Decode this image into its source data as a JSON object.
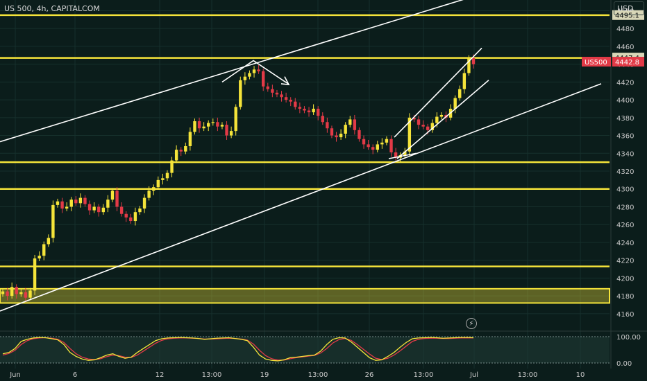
{
  "header": {
    "ticker": "US 500, 4h, CAPITALCOM",
    "currency": "USD"
  },
  "colors": {
    "bg": "#0b1d1b",
    "grid": "#16302c",
    "up": "#f5e43a",
    "down": "#e23a47",
    "level": "#f5e43a",
    "trend": "#ffffff",
    "axis_text": "#c7c7c7"
  },
  "chart_data": {
    "type": "candlestick",
    "ylim": [
      4142,
      4512
    ],
    "y_ticks": [
      4160,
      4180,
      4200,
      4220,
      4240,
      4260,
      4280,
      4300,
      4320,
      4340,
      4360,
      4380,
      4400,
      4420,
      4440,
      4460,
      4480,
      4500
    ],
    "x_ticks": [
      "Jun",
      "6",
      "12",
      "13:00",
      "19",
      "13:00",
      "26",
      "13:00",
      "Jul",
      "13:00",
      "10"
    ],
    "horizontal_levels": [
      4495,
      4447,
      4330,
      4300,
      4213
    ],
    "zone": [
      4172,
      4188
    ],
    "price_labels": [
      {
        "value": 4495.1,
        "text": "4495.1",
        "kind": "level"
      },
      {
        "value": 4447.4,
        "text": "4447.4",
        "kind": "level"
      },
      {
        "value": 4442.8,
        "text": "4442.8",
        "name": "US500",
        "kind": "price"
      }
    ],
    "trendlines": [
      {
        "from": [
          "Jun",
          4353
        ],
        "to": [
          "13:00",
          4517
        ]
      },
      {
        "from": [
          "Jun",
          4163
        ],
        "to": [
          "10",
          4418
        ]
      },
      {
        "from": [
          "26",
          4334
        ],
        "to": [
          "13:00",
          4458
        ]
      },
      {
        "from": [
          "26",
          4334
        ],
        "to": [
          "13:00",
          4422
        ]
      },
      {
        "from": [
          "19",
          4420
        ],
        "to": [
          "19",
          4420
        ]
      }
    ],
    "candles_close": [
      4185,
      4180,
      4190,
      4182,
      4184,
      4178,
      4186,
      4222,
      4225,
      4238,
      4245,
      4282,
      4286,
      4278,
      4280,
      4288,
      4284,
      4290,
      4283,
      4276,
      4280,
      4274,
      4279,
      4288,
      4298,
      4280,
      4272,
      4268,
      4264,
      4274,
      4278,
      4290,
      4298,
      4302,
      4310,
      4312,
      4318,
      4332,
      4344,
      4342,
      4348,
      4364,
      4376,
      4368,
      4370,
      4374,
      4375,
      4370,
      4372,
      4360,
      4365,
      4392,
      4422,
      4426,
      4430,
      4434,
      4432,
      4415,
      4412,
      4408,
      4406,
      4403,
      4400,
      4398,
      4392,
      4390,
      4388,
      4386,
      4390,
      4382,
      4375,
      4368,
      4360,
      4358,
      4362,
      4372,
      4378,
      4366,
      4356,
      4350,
      4347,
      4344,
      4350,
      4352,
      4356,
      4341,
      4335,
      4338,
      4342,
      4380,
      4378,
      4372,
      4370,
      4366,
      4374,
      4381,
      4383,
      4380,
      4390,
      4402,
      4412,
      4430,
      4447,
      4440
    ],
    "oscillator": {
      "ylim": [
        0,
        100
      ],
      "ticks": [
        "100.00",
        "0.00"
      ],
      "k": [
        35,
        40,
        55,
        82,
        90,
        95,
        97,
        96,
        92,
        88,
        70,
        40,
        25,
        15,
        10,
        12,
        20,
        30,
        35,
        25,
        18,
        22,
        40,
        55,
        70,
        85,
        92,
        95,
        96,
        97,
        96,
        95,
        93,
        90,
        92,
        94,
        95,
        96,
        93,
        90,
        85,
        60,
        30,
        15,
        10,
        8,
        12,
        20,
        22,
        25,
        28,
        30,
        45,
        70,
        90,
        96,
        95,
        80,
        60,
        40,
        20,
        10,
        12,
        25,
        40,
        60,
        78,
        92,
        95,
        96,
        97,
        96,
        94,
        95,
        96,
        97,
        97,
        96
      ],
      "d": [
        30,
        36,
        48,
        70,
        85,
        92,
        95,
        96,
        94,
        90,
        78,
        55,
        35,
        22,
        15,
        13,
        16,
        24,
        30,
        28,
        22,
        21,
        30,
        45,
        60,
        75,
        86,
        92,
        94,
        95,
        95,
        94,
        93,
        91,
        91,
        92,
        93,
        94,
        93,
        91,
        87,
        72,
        48,
        28,
        16,
        11,
        11,
        16,
        20,
        23,
        26,
        29,
        38,
        55,
        76,
        89,
        93,
        86,
        70,
        52,
        34,
        18,
        13,
        18,
        30,
        46,
        64,
        82,
        90,
        93,
        94,
        94,
        93,
        93,
        94,
        95,
        95,
        95
      ]
    }
  }
}
